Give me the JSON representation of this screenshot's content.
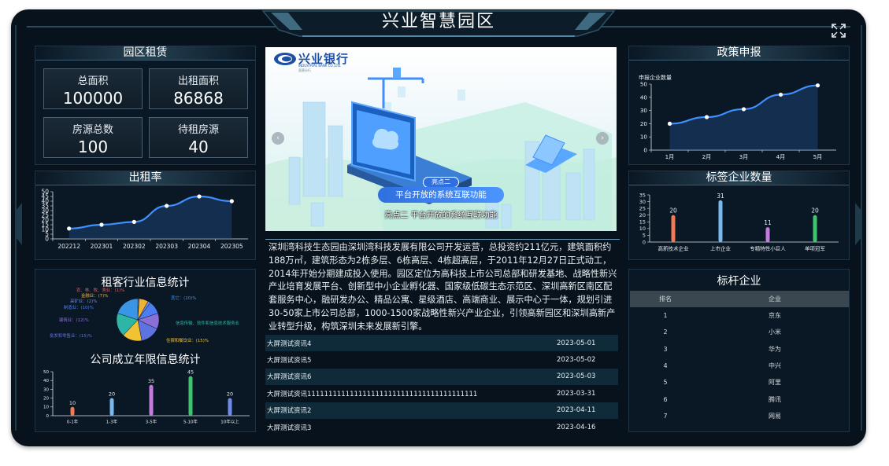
{
  "app": {
    "title": "兴业智慧园区"
  },
  "rent": {
    "title": "园区租赁",
    "stats": [
      {
        "label": "总面积",
        "value": "100000"
      },
      {
        "label": "出租面积",
        "value": "86868"
      },
      {
        "label": "房源总数",
        "value": "100"
      },
      {
        "label": "待租房源",
        "value": "40"
      }
    ]
  },
  "occupancy": {
    "title": "出租率"
  },
  "industry": {
    "title": "租客行业信息统计"
  },
  "years": {
    "title": "公司成立年限信息统计"
  },
  "banner": {
    "bank_name": "兴业银行",
    "bank_en": "INDUSTRIAL BANK CO.,LTD.",
    "bank_sub": "直营分行",
    "badge": "亮点二",
    "pill": "平台开放的系统互联功能",
    "caption": "亮点二 平台开放的系统互联功能"
  },
  "intro": {
    "text": "深圳湾科技生态园由深圳湾科技发展有限公司开发运营，总投资约211亿元，建筑面积约188万㎡，建筑形态为2栋多层、6栋高层、4栋超高层，于2011年12月27日正式动工，2014年开始分期建成投入使用。园区定位为高科技上市公司总部和研发基地、战略性新兴产业培育发展平台、创新型中小企业孵化器、国家级低碳生态示范区、深圳高新区南区配套服务中心，融研发办公、精品公寓、星级酒店、高端商业、展示中心于一体，规划引进30-50家上市公司总部，1000-1500家战略性新兴产业企业，引领高新园区和深圳高新产业转型升级，构筑深圳未来发展新引擎。"
  },
  "news": [
    {
      "title": "大屏测试资讯4",
      "date": "2023-05-01"
    },
    {
      "title": "大屏测试资讯5",
      "date": "2023-05-02"
    },
    {
      "title": "大屏测试资讯6",
      "date": "2023-05-03"
    },
    {
      "title": "大屏测试资讯1111111111111111111111111111111111111111",
      "date": "2023-03-31"
    },
    {
      "title": "大屏测试资讯2",
      "date": "2023-04-11"
    },
    {
      "title": "大屏测试资讯3",
      "date": "2023-04-16"
    }
  ],
  "policy": {
    "title": "政策申报"
  },
  "tags": {
    "title": "标签企业数量"
  },
  "benchmark": {
    "title": "标杆企业",
    "headers": [
      "排名",
      "企业"
    ],
    "rows": [
      {
        "rank": "1",
        "name": "京东"
      },
      {
        "rank": "2",
        "name": "小米"
      },
      {
        "rank": "3",
        "name": "华为"
      },
      {
        "rank": "4",
        "name": "中兴"
      },
      {
        "rank": "5",
        "name": "阿里"
      },
      {
        "rank": "6",
        "name": "腾讯"
      },
      {
        "rank": "7",
        "name": "网易"
      }
    ]
  },
  "colors": {
    "accent": "#5aa7ff",
    "frame": "#1f3546",
    "bg": "#07121c"
  },
  "chart_data": [
    {
      "id": "occupancy",
      "type": "line",
      "categories": [
        "202212",
        "202301",
        "202302",
        "202303",
        "202304",
        "202305"
      ],
      "values": [
        11,
        15,
        18,
        35,
        45,
        40
      ],
      "ylim": [
        0,
        50
      ],
      "yticks": [
        0,
        5,
        10,
        15,
        20,
        25,
        30,
        35,
        40,
        45,
        50
      ],
      "color": "#3f8fff"
    },
    {
      "id": "policy",
      "type": "line",
      "ylabel": "申报企业数量",
      "categories": [
        "1月",
        "2月",
        "3月",
        "4月",
        "5月"
      ],
      "values": [
        20,
        25,
        31,
        42,
        49
      ],
      "ylim": [
        0,
        50
      ],
      "yticks": [
        0,
        10,
        20,
        30,
        40,
        50
      ],
      "color": "#3f8fff"
    },
    {
      "id": "tags",
      "type": "bar",
      "categories": [
        "高新技术企业",
        "上市企业",
        "专精特性小巨人",
        "单项冠军"
      ],
      "values": [
        20,
        31,
        11,
        20
      ],
      "colors": [
        "#f07a55",
        "#7bb8ef",
        "#c57ae0",
        "#3fc46e"
      ],
      "ylim": [
        0,
        35
      ],
      "yticks": [
        0,
        5,
        10,
        15,
        20,
        25,
        30,
        35
      ]
    },
    {
      "id": "years",
      "type": "bar",
      "categories": [
        "0-1年",
        "1-3年",
        "3-5年",
        "5-10年",
        "10年以上"
      ],
      "values": [
        10,
        20,
        35,
        45,
        20
      ],
      "colors": [
        "#f07a55",
        "#7bb8ef",
        "#c57ae0",
        "#3fc46e",
        "#6f8de8"
      ],
      "ylim": [
        0,
        50
      ],
      "yticks": [
        0,
        10,
        20,
        30,
        40,
        50
      ]
    },
    {
      "id": "industry",
      "type": "pie",
      "slices": [
        {
          "label": "农、林、牧、渔业：(1)%",
          "value": 1,
          "color": "#e35c5c"
        },
        {
          "label": "金融业：(7)%",
          "value": 7,
          "color": "#f2b233"
        },
        {
          "label": "采矿业：(2)%",
          "value": 2,
          "color": "#6f8de8"
        },
        {
          "label": "制造业：(10)%",
          "value": 10,
          "color": "#4c7ef2"
        },
        {
          "label": "建筑业：(12)%",
          "value": 12,
          "color": "#8a6fd6"
        },
        {
          "label": "批发和零售业：(15)%",
          "value": 15,
          "color": "#5f73e0"
        },
        {
          "label": "住宿和餐饮业：(15)%",
          "value": 15,
          "color": "#f1c232"
        },
        {
          "label": "信息传输、软件和信息技术服务业",
          "value": 18,
          "color": "#2fb5a5"
        },
        {
          "label": "其它：(20)%",
          "value": 20,
          "color": "#3b95e6"
        }
      ]
    }
  ]
}
